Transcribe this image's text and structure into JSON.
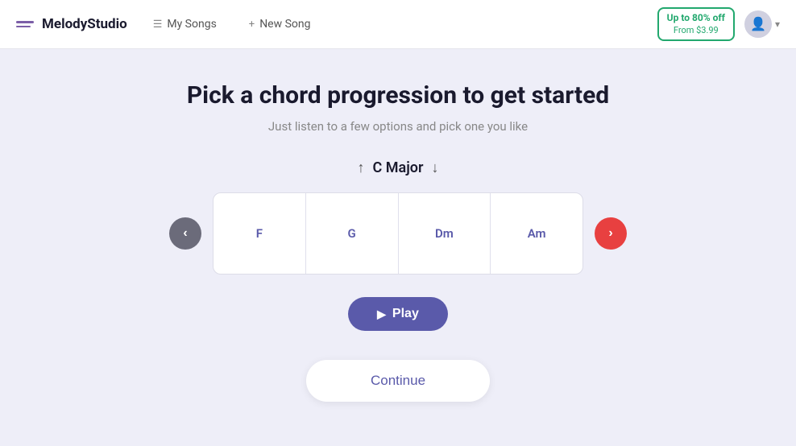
{
  "header": {
    "logo_text": "MelodyStudio",
    "nav_my_songs": "My Songs",
    "nav_new_song": "New Song",
    "promo_top": "Up to 80% off",
    "promo_bottom": "From $3.99"
  },
  "main": {
    "title": "Pick a chord progression to get started",
    "subtitle": "Just listen to a few options and pick one you like",
    "key_up_arrow": "↑",
    "key_label": "C  Major",
    "key_down_arrow": "↓",
    "chords": [
      {
        "label": "F"
      },
      {
        "label": "G"
      },
      {
        "label": "Dm"
      },
      {
        "label": "Am"
      }
    ],
    "play_button": "Play",
    "continue_button": "Continue"
  }
}
